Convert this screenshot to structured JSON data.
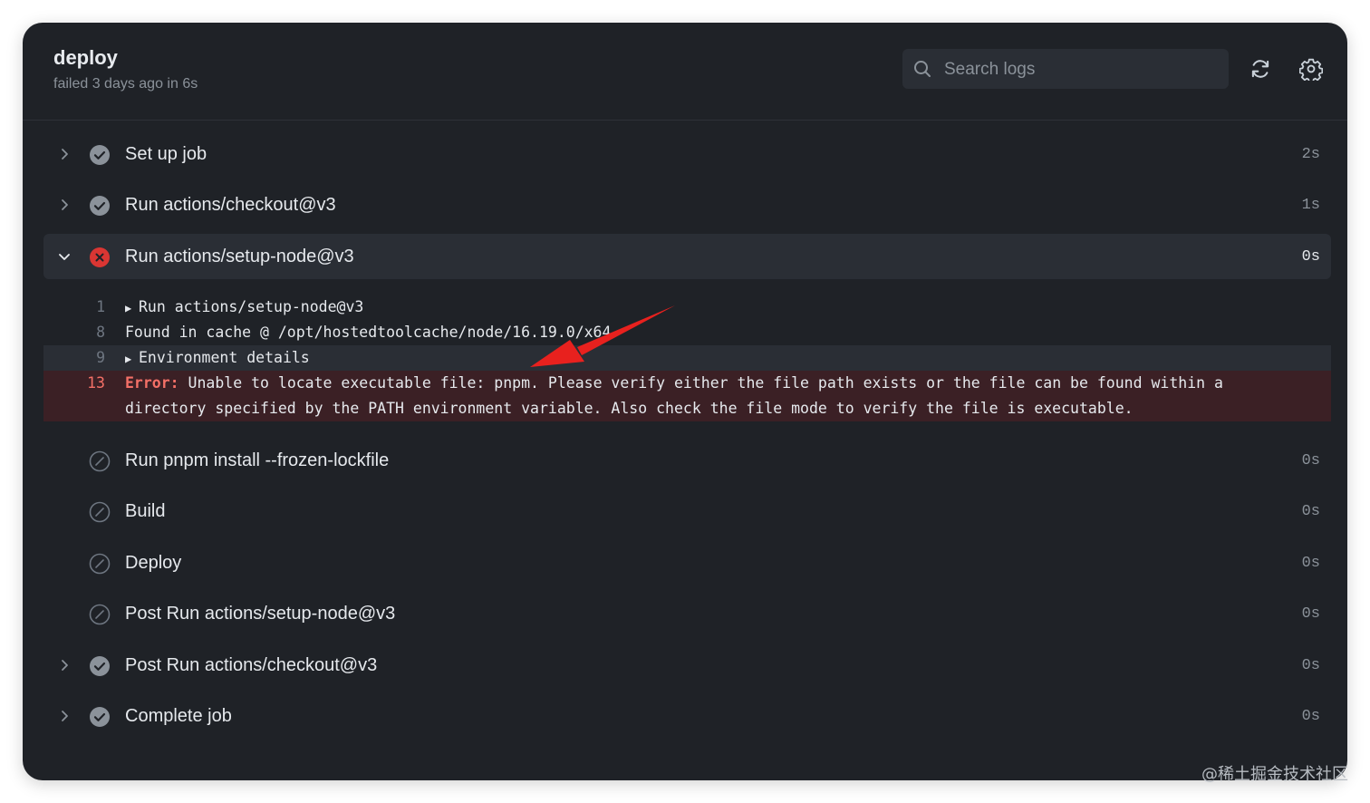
{
  "job": {
    "title": "deploy",
    "subtitle": "failed 3 days ago in 6s"
  },
  "search": {
    "placeholder": "Search logs"
  },
  "header_buttons": {
    "refresh": "refresh-icon",
    "settings": "gear-icon"
  },
  "colors": {
    "panel": "#1f2227",
    "success": "#8b929a",
    "failure": "#da3633",
    "error_bg": "#3b2025"
  },
  "steps": [
    {
      "name": "Set up job",
      "duration": "2s",
      "status": "success"
    },
    {
      "name": "Run actions/checkout@v3",
      "duration": "1s",
      "status": "success"
    },
    {
      "name": "Run actions/setup-node@v3",
      "duration": "0s",
      "status": "failure"
    },
    {
      "name": "Run pnpm install --frozen-lockfile",
      "duration": "0s",
      "status": "skipped"
    },
    {
      "name": "Build",
      "duration": "0s",
      "status": "skipped"
    },
    {
      "name": "Deploy",
      "duration": "0s",
      "status": "skipped"
    },
    {
      "name": "Post Run actions/setup-node@v3",
      "duration": "0s",
      "status": "skipped"
    },
    {
      "name": "Post Run actions/checkout@v3",
      "duration": "0s",
      "status": "success"
    },
    {
      "name": "Complete job",
      "duration": "0s",
      "status": "success"
    }
  ],
  "log": {
    "lines": [
      {
        "num": "1",
        "text": "Run actions/setup-node@v3"
      },
      {
        "num": "8",
        "text": "Found in cache @ /opt/hostedtoolcache/node/16.19.0/x64"
      },
      {
        "num": "9",
        "text": "Environment details"
      }
    ],
    "error": {
      "num": "13",
      "keyword": "Error:",
      "line1": " Unable to locate executable file: pnpm. Please verify either the file path exists or the file can be found within a",
      "line2": "directory specified by the PATH environment variable. Also check the file mode to verify the file is executable."
    }
  },
  "watermark": "@稀土掘金技术社区"
}
